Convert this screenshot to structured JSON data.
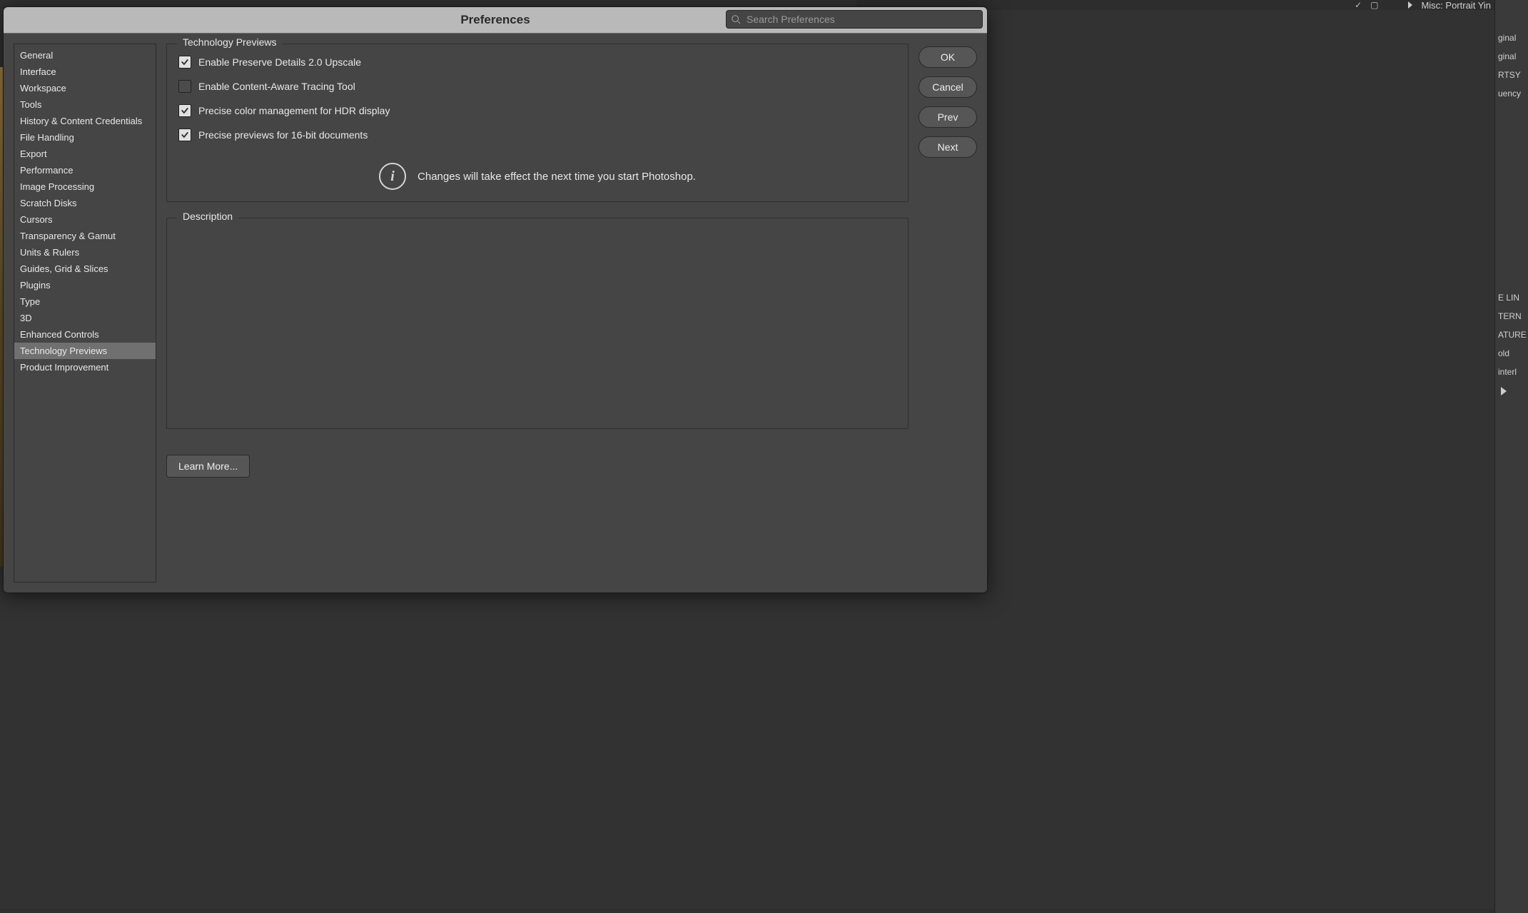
{
  "title": "Preferences",
  "search": {
    "placeholder": "Search Preferences"
  },
  "sidebar": {
    "items": [
      {
        "label": "General"
      },
      {
        "label": "Interface"
      },
      {
        "label": "Workspace"
      },
      {
        "label": "Tools"
      },
      {
        "label": "History & Content Credentials"
      },
      {
        "label": "File Handling"
      },
      {
        "label": "Export"
      },
      {
        "label": "Performance"
      },
      {
        "label": "Image Processing"
      },
      {
        "label": "Scratch Disks"
      },
      {
        "label": "Cursors"
      },
      {
        "label": "Transparency & Gamut"
      },
      {
        "label": "Units & Rulers"
      },
      {
        "label": "Guides, Grid & Slices"
      },
      {
        "label": "Plugins"
      },
      {
        "label": "Type"
      },
      {
        "label": "3D"
      },
      {
        "label": "Enhanced Controls"
      },
      {
        "label": "Technology Previews",
        "active": true
      },
      {
        "label": "Product Improvement"
      }
    ]
  },
  "main": {
    "section_title": "Technology Previews",
    "options": [
      {
        "label": "Enable Preserve Details 2.0 Upscale",
        "checked": true
      },
      {
        "label": "Enable Content-Aware Tracing Tool",
        "checked": false
      },
      {
        "label": "Precise color management for HDR display",
        "checked": true
      },
      {
        "label": "Precise previews for 16-bit documents",
        "checked": true
      }
    ],
    "info_text": "Changes will take effect the next time you start Photoshop.",
    "description_title": "Description",
    "learn_more": "Learn More..."
  },
  "buttons": {
    "ok": "OK",
    "cancel": "Cancel",
    "prev": "Prev",
    "next": "Next"
  },
  "bg_top": {
    "breadcrumb": "Misc: Portrait Yin"
  },
  "bg_right": {
    "items": [
      "ginal",
      "ginal",
      "RTSY",
      "uency",
      "",
      "",
      "",
      "",
      "E LIN",
      "TERN",
      "ATURE",
      "old",
      "interl"
    ]
  }
}
